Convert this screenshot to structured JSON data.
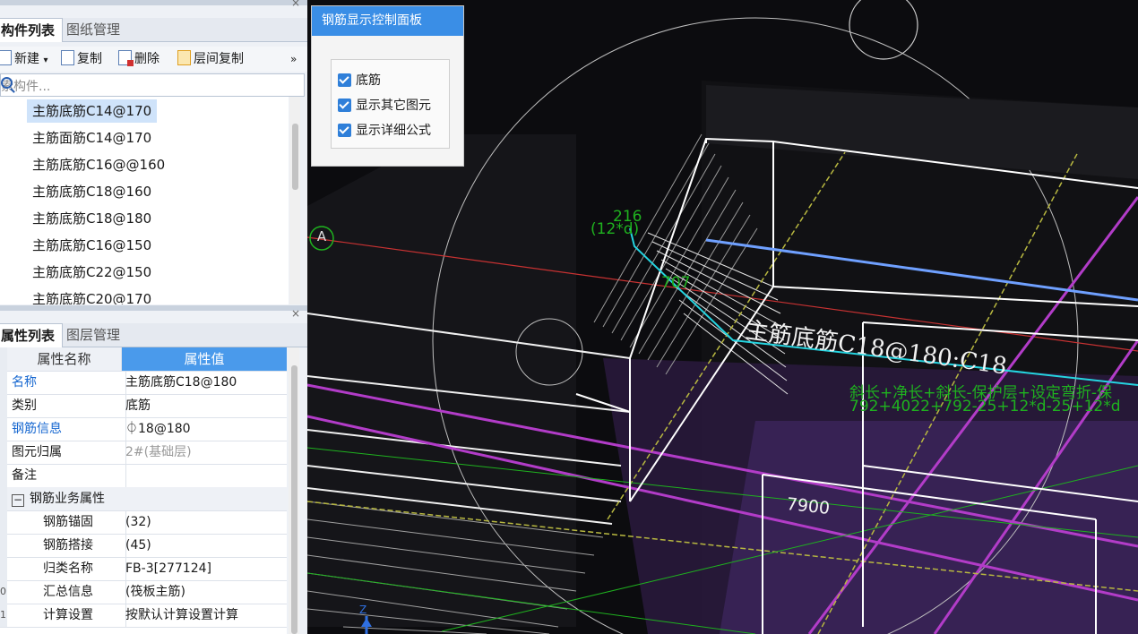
{
  "top_pane": {
    "tabs": [
      "构件列表",
      "图纸管理"
    ],
    "close": "×",
    "toolbar": {
      "new_label": "新建",
      "new_arrow": "▾",
      "copy_label": "复制",
      "delete_label": "删除",
      "layer_copy_label": "层间复制",
      "more": "»"
    },
    "search_placeholder": "索构件...",
    "components": [
      "主筋底筋C14@170",
      "主筋面筋C14@170",
      "主筋底筋C16@@160",
      "主筋底筋C18@160",
      "主筋底筋C18@180",
      "主筋底筋C16@150",
      "主筋底筋C22@150",
      "主筋底筋C20@170"
    ]
  },
  "bottom_pane": {
    "tabs": [
      "属性列表",
      "图层管理"
    ],
    "close": "×",
    "header": {
      "name": "属性名称",
      "value": "属性值"
    },
    "rows": [
      {
        "name": "名称",
        "value": "主筋底筋C18@180"
      },
      {
        "name": "类别",
        "value": "底筋"
      },
      {
        "name": "钢筋信息",
        "value": "⏀18@180"
      },
      {
        "name": "图元归属",
        "value": "2#(基础层)"
      },
      {
        "name": "备注",
        "value": ""
      },
      {
        "name": "钢筋业务属性",
        "value": "",
        "toggle": "−"
      },
      {
        "name": "钢筋锚固",
        "value": "(32)"
      },
      {
        "name": "钢筋搭接",
        "value": "(45)"
      },
      {
        "name": "归类名称",
        "value": "FB-3[277124]"
      },
      {
        "name": "汇总信息",
        "value": "(筏板主筋)",
        "rownum": "0"
      },
      {
        "name": "计算设置",
        "value": "按默认计算设置计算",
        "rownum": "1"
      }
    ]
  },
  "control_panel": {
    "title": "钢筋显示控制面板",
    "options": [
      {
        "label": "底筋",
        "checked": true
      },
      {
        "label": "显示其它图元",
        "checked": true
      },
      {
        "label": "显示详细公式",
        "checked": true
      }
    ]
  },
  "viewport": {
    "axis_label": "A",
    "dim_216": "216",
    "dim_12d": "(12*d)",
    "dim_707": "707",
    "rebar_label": "主筋底筋C18@180:C18",
    "formula_line1": "斜长+净长+斜长-保护层+设定弯折-保",
    "formula_line2": "792+4022+792-25+12*d-25+12*d",
    "dim_7900": "7900",
    "axis_z": "Z"
  },
  "colors": {
    "tab_active_header": "#4a9aeb",
    "panel_title": "#3a8ee6",
    "selection": "#cfe3fa",
    "link_blue": "#1667d0",
    "canvas_bg": "#0c0c0f",
    "rebar_green": "#1fb21f",
    "highlight_blue": "#6fa0ff",
    "cyan": "#25d4e0",
    "magenta": "#b23cc8"
  }
}
